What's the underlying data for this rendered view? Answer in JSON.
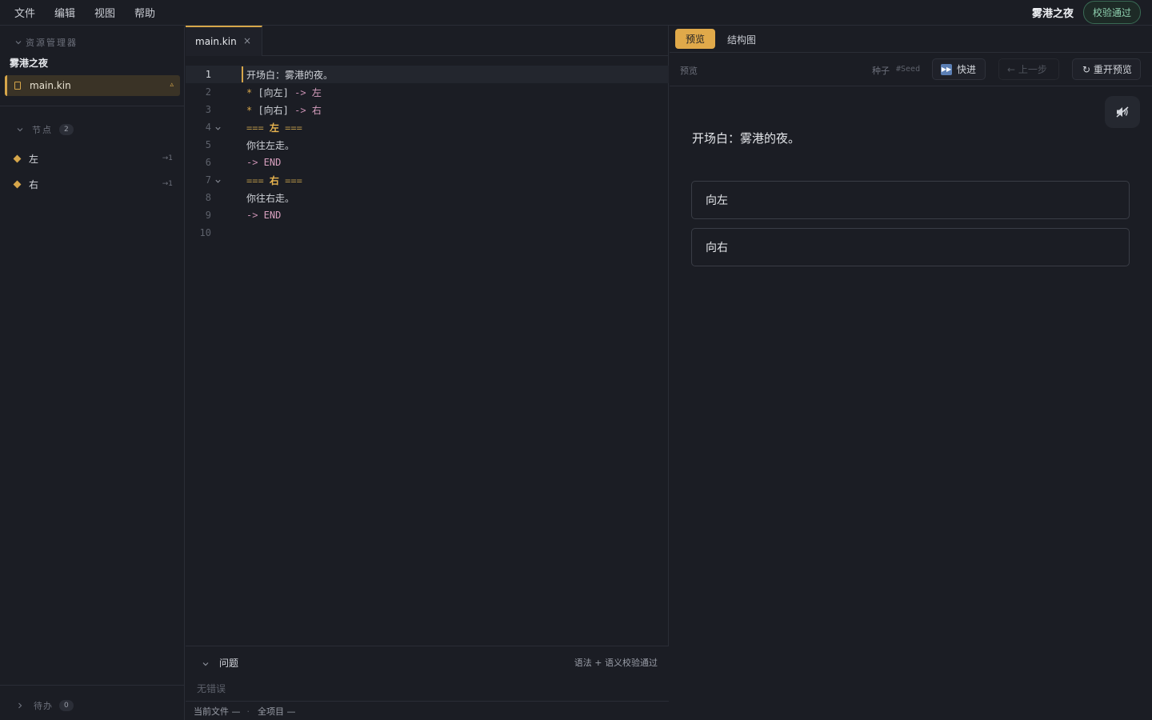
{
  "menubar": {
    "items": [
      "文件",
      "编辑",
      "视图",
      "帮助"
    ],
    "project_name": "雾港之夜",
    "validation_badge": "校验通过"
  },
  "sidebar": {
    "explorer_title": "资源管理器",
    "project_title": "雾港之夜",
    "file": {
      "name": "main.kin",
      "warn_icon": "▵"
    },
    "nodes_title": "节点",
    "nodes_count": "2",
    "nodes": [
      {
        "label": "左",
        "refs": "→1"
      },
      {
        "label": "右",
        "refs": "→1"
      }
    ],
    "todo_title": "待办",
    "todo_count": "0"
  },
  "editor": {
    "tab_label": "main.kin",
    "tab_close": "×",
    "line_numbers": [
      "1",
      "2",
      "3",
      "4",
      "5",
      "6",
      "7",
      "8",
      "9",
      "10"
    ],
    "lines": {
      "l1": "开场白：雾港的夜。",
      "l2_star": "*",
      "l2_choice": " [向左] ",
      "l2_arrow": "->",
      "l2_target": " 左",
      "l3_star": "*",
      "l3_choice": " [向右] ",
      "l3_arrow": "->",
      "l3_target": " 右",
      "l4_eq1": "===",
      "l4_knot": " 左 ",
      "l4_eq2": "===",
      "l5": "你往左走。",
      "l6_arrow": "->",
      "l6_target": " END",
      "l7_eq1": "===",
      "l7_knot": " 右 ",
      "l7_eq2": "===",
      "l8": "你往右走。",
      "l9_arrow": "->",
      "l9_target": " END"
    },
    "problems": {
      "title": "问题",
      "status": "语法 + 语义校验通过",
      "empty": "无错误"
    },
    "statusbar": {
      "current_file": "当前文件 —",
      "dot": "·",
      "all_project": "全项目 —"
    }
  },
  "preview": {
    "tab_preview": "预览",
    "tab_structure": "结构图",
    "toolbar_label": "预览",
    "seed_label": "种子",
    "seed_value": "#Seed",
    "fast_forward": "快进",
    "back": "← 上一步",
    "restart": "重开预览",
    "story_text": "开场白：雾港的夜。",
    "choices": [
      "向左",
      "向右"
    ]
  },
  "icons": {
    "chevron": "chevron-down-icon",
    "file": "file-icon",
    "node": "diamond-icon",
    "audio": "speaker-muted-icon",
    "fast_forward": "fast-forward-icon",
    "restart": "restart-icon"
  },
  "colors": {
    "accent": "#d6a64a",
    "background": "#1b1d24",
    "validation": "#8fd1b0"
  }
}
